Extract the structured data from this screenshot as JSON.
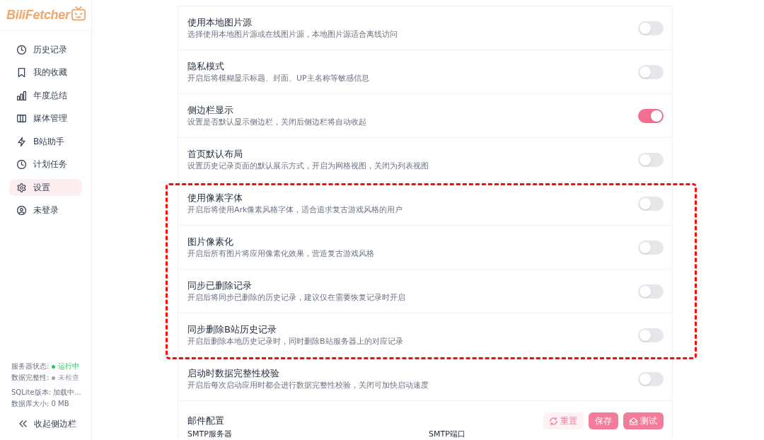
{
  "sidebar": {
    "logo": "BiliFetcher",
    "nav": [
      {
        "label": "历史记录",
        "selected": false
      },
      {
        "label": "我的收藏",
        "selected": false
      },
      {
        "label": "年度总结",
        "selected": false
      },
      {
        "label": "媒体管理",
        "selected": false
      },
      {
        "label": "B站助手",
        "selected": false
      },
      {
        "label": "计划任务",
        "selected": false
      },
      {
        "label": "设置",
        "selected": true
      },
      {
        "label": "未登录",
        "selected": false
      }
    ],
    "status": [
      {
        "label": "服务器状态:",
        "value": "运行中",
        "color": "#22c55e"
      },
      {
        "label": "数据完整性:",
        "value": "未检查",
        "color": "#9ca3af"
      }
    ],
    "info": [
      "SQLite版本: 加载中...",
      "数据库大小: 0 MB"
    ],
    "collapse": "收起侧边栏"
  },
  "settings": [
    {
      "title": "使用本地图片源",
      "description": "选择使用本地图片源或在线图片源，本地图片源适合离线访问",
      "on": false,
      "highlighted": false
    },
    {
      "title": "隐私模式",
      "description": "开启后将模糊显示标题、封面、UP主名称等敏感信息",
      "on": false,
      "highlighted": false
    },
    {
      "title": "侧边栏显示",
      "description": "设置是否默认显示侧边栏，关闭后侧边栏将自动收起",
      "on": true,
      "highlighted": false
    },
    {
      "title": "首页默认布局",
      "description": "设置历史记录页面的默认展示方式，开启为网格视图，关闭为列表视图",
      "on": false,
      "highlighted": false
    },
    {
      "title": "使用像素字体",
      "description": "开启后将使用Ark像素风格字体，适合追求复古游戏风格的用户",
      "on": false,
      "highlighted": true
    },
    {
      "title": "图片像素化",
      "description": "开启后所有图片将应用像素化效果，营造复古游戏风格",
      "on": false,
      "highlighted": true
    },
    {
      "title": "同步已删除记录",
      "description": "开启后将同步已删除的历史记录，建议仅在需要恢复记录时开启",
      "on": false,
      "highlighted": true
    },
    {
      "title": "同步删除B站历史记录",
      "description": "开启后删除本地历史记录时，同时删除B站服务器上的对应记录",
      "on": false,
      "highlighted": true
    },
    {
      "title": "启动时数据完整性校验",
      "description": "开启后每次启动应用时都会进行数据完整性校验，关闭可加快启动速度",
      "on": false,
      "highlighted": false
    }
  ],
  "email": {
    "title": "邮件配置",
    "buttons": [
      {
        "kind": "reset",
        "label": "重置"
      },
      {
        "kind": "save",
        "label": "保存"
      },
      {
        "kind": "test",
        "label": "测试"
      }
    ],
    "fields": [
      {
        "label": "SMTP服务器"
      },
      {
        "label": "SMTP端口"
      }
    ]
  }
}
